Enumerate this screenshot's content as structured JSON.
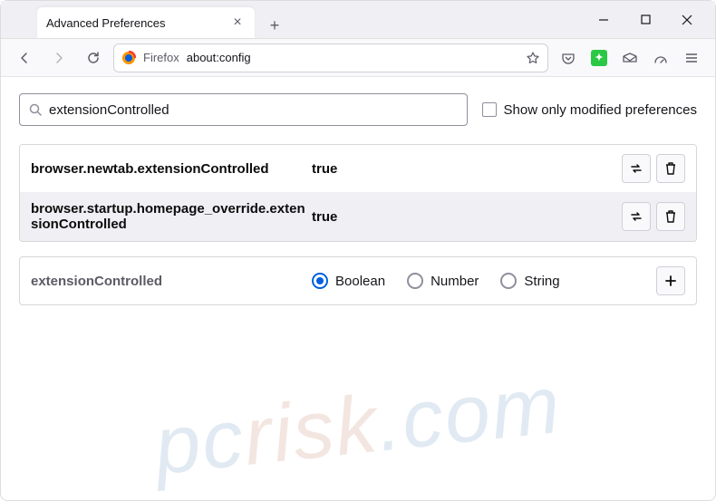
{
  "titlebar": {
    "tab_title": "Advanced Preferences"
  },
  "toolbar": {
    "url_label": "Firefox",
    "url_text": "about:config"
  },
  "search": {
    "value": "extensionControlled",
    "checkbox_label": "Show only modified preferences"
  },
  "prefs": [
    {
      "name": "browser.newtab.extensionControlled",
      "value": "true"
    },
    {
      "name": "browser.startup.homepage_override.extensionControlled",
      "value": "true"
    }
  ],
  "new_pref": {
    "name": "extensionControlled",
    "types": [
      "Boolean",
      "Number",
      "String"
    ],
    "selected": 0
  },
  "watermark": "pcrisk.com"
}
